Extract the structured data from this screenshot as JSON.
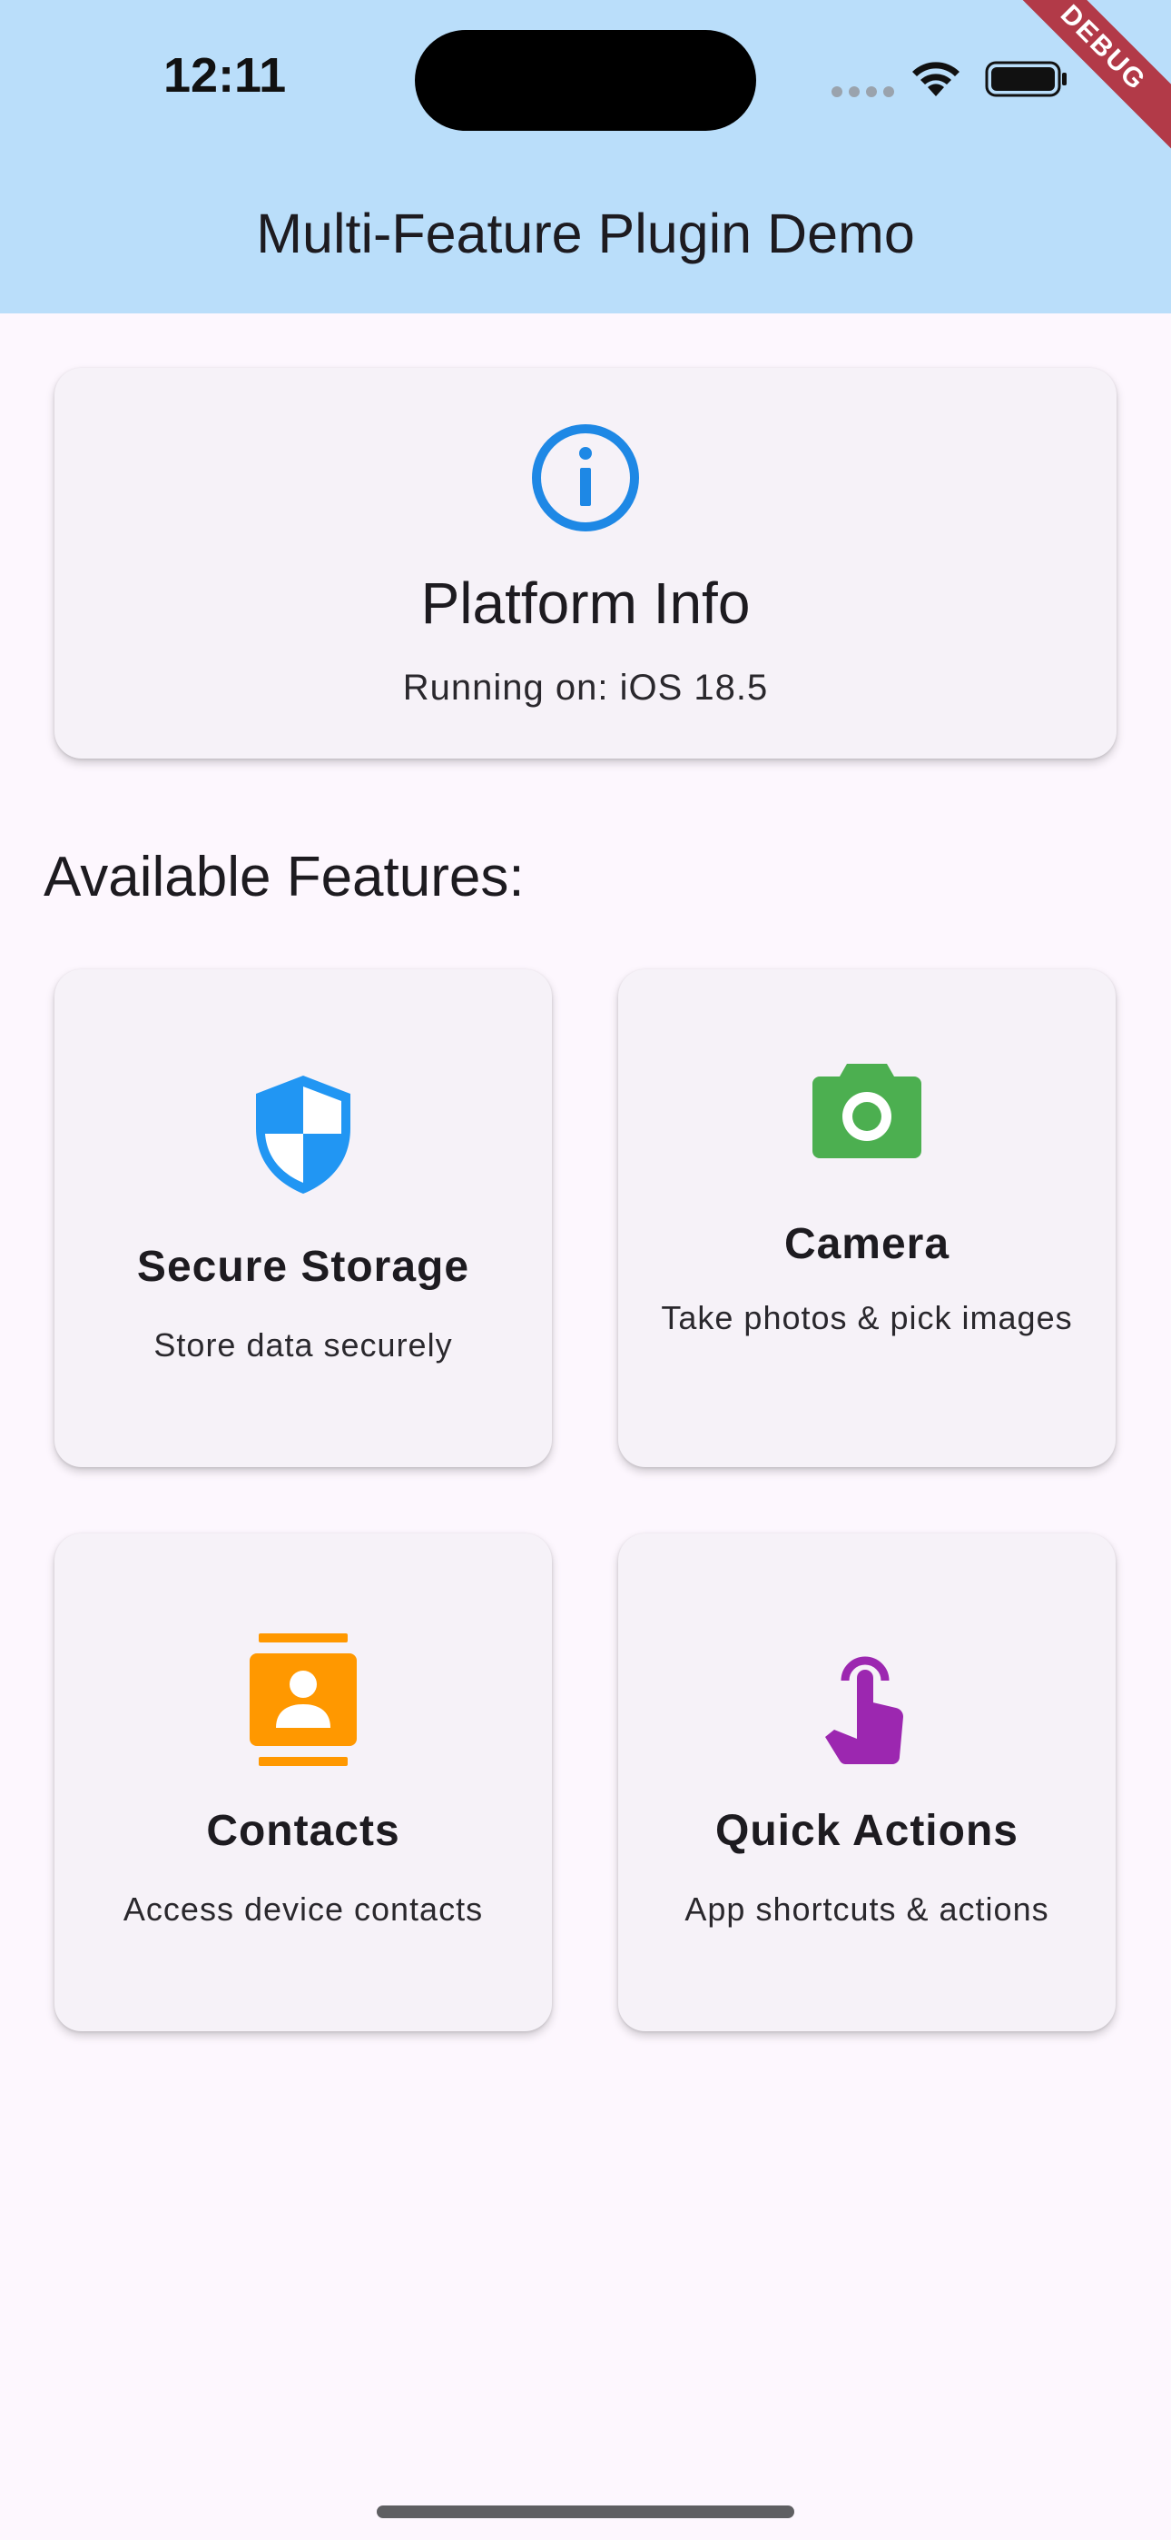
{
  "status_bar": {
    "time": "12:11",
    "wifi_icon": "wifi-icon",
    "battery_icon": "battery-icon"
  },
  "debug_banner": "DEBUG",
  "app_bar": {
    "title": "Multi-Feature Plugin Demo",
    "background": "#badefa"
  },
  "platform_card": {
    "icon": "info-icon",
    "icon_color": "#1e88e5",
    "title": "Platform Info",
    "subtitle": "Running on: iOS 18.5"
  },
  "section": {
    "title": "Available Features:"
  },
  "features": [
    {
      "title": "Secure Storage",
      "description": "Store data securely",
      "icon": "shield-icon",
      "icon_color": "#2196f3"
    },
    {
      "title": "Camera",
      "description": "Take photos & pick images",
      "icon": "camera-icon",
      "icon_color": "#4caf50"
    },
    {
      "title": "Contacts",
      "description": "Access device contacts",
      "icon": "contact-card-icon",
      "icon_color": "#ff9800"
    },
    {
      "title": "Quick Actions",
      "description": "App shortcuts & actions",
      "icon": "touch-icon",
      "icon_color": "#9c27b0"
    }
  ]
}
